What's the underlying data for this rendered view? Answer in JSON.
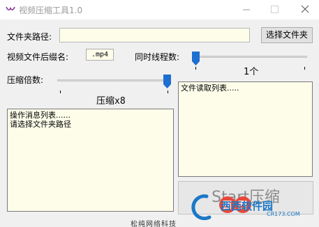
{
  "window": {
    "title": "视频压缩工具1.0",
    "icon": "bow-logo-icon"
  },
  "form": {
    "folder_path_label": "文件夹路径:",
    "folder_path_value": "",
    "choose_folder_button": "选择文件夹",
    "video_suffix_label": "视频文件后缀名:",
    "video_suffix_value": ".mp4",
    "threads_label": "同时线程数:",
    "threads_value_text": "1个",
    "threads_level": 0,
    "compression_label": "压缩倍数:",
    "compression_value_text": "压缩x8",
    "compression_level": 1
  },
  "file_list": {
    "title": "文件读取列表....."
  },
  "log": {
    "lines": [
      "操作消息列表......",
      "请选择文件夹路径"
    ]
  },
  "start_button": "Start压缩",
  "footer": "松纯网络科技",
  "watermark": {
    "brand": "西西软件园",
    "url": "CR173.COM"
  },
  "colors": {
    "input_bg": "#fdfdea",
    "slider_thumb": "#1e6fd0",
    "watermark": "#1b78c6"
  }
}
